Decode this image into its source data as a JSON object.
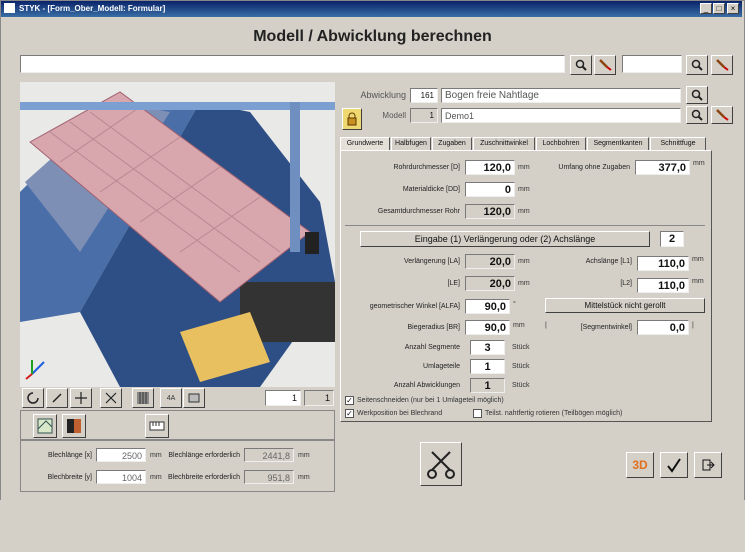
{
  "window": {
    "title": "STYK - [Form_Ober_Modell: Formular]",
    "min": "_",
    "max": "□",
    "close": "×"
  },
  "heading": "Modell / Abwicklung berechnen",
  "header_fields": {
    "abwicklung_label": "Abwicklung",
    "abwicklung_nr": "161",
    "abwicklung_name": "Bogen freie Nahtlage",
    "modell_label": "Modell",
    "modell_nr": "1",
    "modell_name": "Demo1"
  },
  "tabs": [
    "Grundwerte",
    "Halbfugen",
    "Zugaben",
    "Zuschnittwinkel",
    "Lochbohren",
    "Segmentkanten",
    "Schnittfuge"
  ],
  "grundwerte": {
    "rohrdurchmesser_label": "Rohrdurchmesser [D]",
    "rohrdurchmesser": "120,0",
    "rohrdurchmesser_unit": "mm",
    "umfang_label": "Umfang ohne Zugaben",
    "umfang": "377,0",
    "umfang_unit": "mm",
    "materialdicke_label": "Materialdicke [DD]",
    "materialdicke": "0",
    "materialdicke_unit": "mm",
    "gesamt_label": "Gesamtdurchmesser Rohr",
    "gesamt": "120,0",
    "gesamt_unit": "mm",
    "eingabe_label": "Eingabe (1) Verlängerung oder (2) Achslänge",
    "eingabe_value": "2",
    "verl_label": "Verlängerung [LA]",
    "verl": "20,0",
    "verl_unit": "mm",
    "achs_label": "Achslänge [L1]",
    "achs": "110,0",
    "achs_unit": "mm",
    "l2_left_label": "[LE]",
    "l2_left": "20,0",
    "l2_left_unit": "mm",
    "l2_right_label": "[L2]",
    "l2_right": "110,0",
    "l2_right_unit": "mm",
    "winkel_label": "geometrischer Winkel [ALFA]",
    "winkel": "90,0",
    "winkel_unit": "°",
    "mittelstueck_label": "Mittelstück nicht gerollt",
    "radius_label": "Biegeradius [BR]",
    "radius": "90,0",
    "radius_unit": "mm",
    "radius_bracket": "|",
    "segwinkel_label": "[Segmentwinkel]",
    "segwinkel": "0,0",
    "segwinkel_bracket": "|",
    "segmente_label": "Anzahl Segmente",
    "segmente": "3",
    "segmente_unit": "Stück",
    "umlage_label": "Umlageteile",
    "umlage": "1",
    "umlage_unit": "Stück",
    "abw_label": "Anzahl Abwicklungen",
    "abw": "1",
    "abw_unit": "Stück",
    "cb1": "Seitenschneiden (nur bei 1 Umlageteil möglich)",
    "cb2": "Werkposition bei Blechrand",
    "cb3": "Teilst. nahtfertig rotieren (Teilbögen möglich)"
  },
  "bottom": {
    "blechlaenge_label": "Blechlänge [x]",
    "blechlaenge": "2500",
    "blechlaenge_unit": "mm",
    "blechbreite_label": "Blechbreite [y]",
    "blechbreite": "1004",
    "blechbreite_unit": "mm",
    "laenge_erf_label": "Blechlänge erforderlich",
    "laenge_erf": "2441,8",
    "laenge_erf_unit": "mm",
    "breite_erf_label": "Blechbreite erforderlich",
    "breite_erf": "951,8",
    "breite_erf_unit": "mm",
    "spin_value": "1",
    "spin_value2": "1",
    "btn_3d": "3D",
    "small_tag": "4A"
  },
  "colors": {
    "title_bar": "#0a246a",
    "panel": "#d4d0c8",
    "accent_3d": "#e07020"
  }
}
